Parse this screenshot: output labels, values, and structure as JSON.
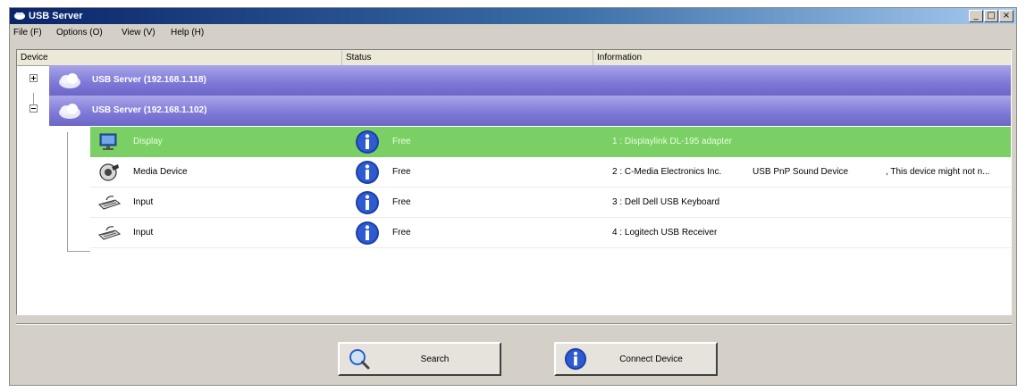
{
  "window": {
    "title": "USB Server",
    "controls": [
      "_",
      "□",
      "×"
    ]
  },
  "menu": [
    "File (F)",
    "Options (O)",
    "View (V)",
    "Help (H)"
  ],
  "columns": {
    "device": "Device",
    "status": "Status",
    "information": "Information"
  },
  "servers": [
    {
      "label": "USB Server (192.168.1.118)",
      "expanded": false
    },
    {
      "label": "USB Server (192.168.1.102)",
      "expanded": true
    }
  ],
  "devices": [
    {
      "icon": "display-icon",
      "name": "Display",
      "status": "Free",
      "info": "1 : Displaylink DL-195 adapter",
      "info_extra": "",
      "info_more": "",
      "selected": true
    },
    {
      "icon": "media-device-icon",
      "name": "Media Device",
      "status": "Free",
      "info": "2 : C-Media Electronics Inc.",
      "info_extra": "USB PnP Sound Device",
      "info_more": ", This device might not n...",
      "selected": false
    },
    {
      "icon": "keyboard-icon",
      "name": "Input",
      "status": "Free",
      "info": "3 : Dell Dell USB Keyboard",
      "info_extra": "",
      "info_more": "",
      "selected": false
    },
    {
      "icon": "receiver-icon",
      "name": "Input",
      "status": "Free",
      "info": "4 : Logitech USB Receiver",
      "info_extra": "",
      "info_more": "",
      "selected": false
    }
  ],
  "buttons": {
    "search": "Search",
    "connect": "Connect Device"
  },
  "colors": {
    "server_row": "#7d78d6",
    "selected_row": "#7ad064",
    "info_badge": "#1c3fa8"
  }
}
